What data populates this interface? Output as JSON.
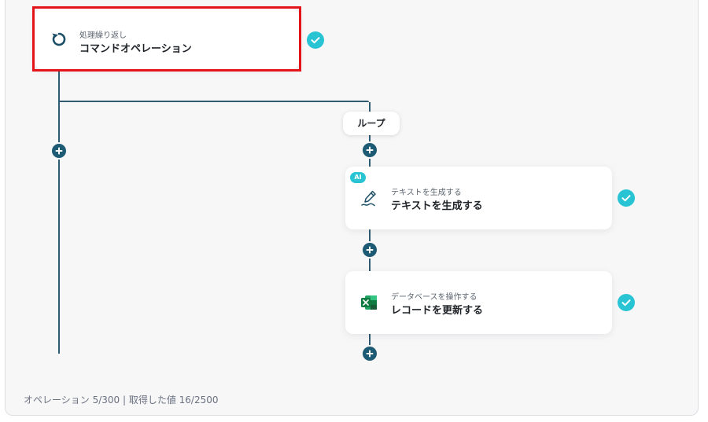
{
  "flow": {
    "loop_node": {
      "subtitle": "処理繰り返し",
      "title": "コマンドオペレーション",
      "icon": "loop-icon"
    },
    "loop_label": "ループ",
    "steps": [
      {
        "badge": "AI",
        "subtitle": "テキストを生成する",
        "title": "テキストを生成する",
        "icon": "pen-icon"
      },
      {
        "subtitle": "データベースを操作する",
        "title": "レコードを更新する",
        "icon": "excel-icon"
      }
    ]
  },
  "footer": {
    "status": "オペレーション 5/300 | 取得した値 16/2500"
  },
  "colors": {
    "line": "#2f5b73",
    "plus": "#1d5a73",
    "check": "#28c4d4",
    "highlight": "#e3141a",
    "excel_green": "#1f7a45"
  }
}
